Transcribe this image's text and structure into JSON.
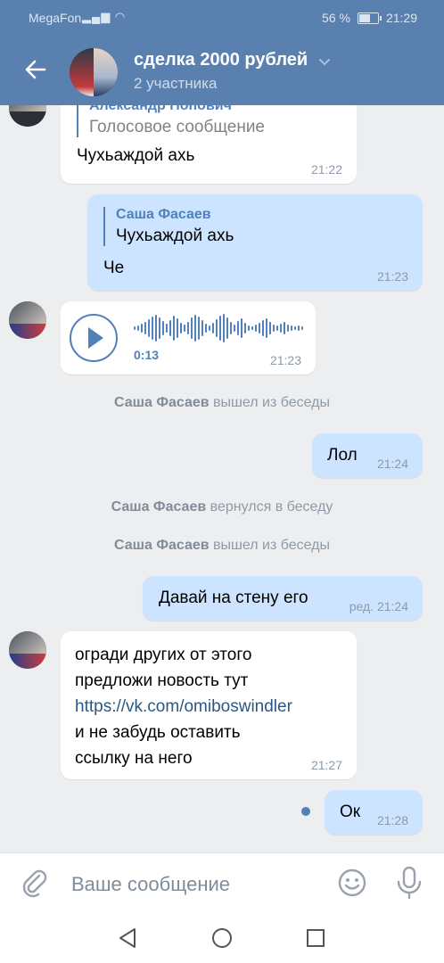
{
  "status_bar": {
    "carrier": "MegaFon",
    "battery": "56 %",
    "time": "21:29"
  },
  "header": {
    "title": "сделка 2000 рублей",
    "subtitle": "2 участника",
    "back_icon": "arrow-left-icon",
    "chevron_icon": "chevron-down-icon"
  },
  "messages": {
    "m1": {
      "reply_author": "Александр Попович",
      "reply_text": "Голосовое сообщение",
      "text": "Чухьаждой ахь",
      "time": "21:22"
    },
    "m2": {
      "reply_author": "Саша Фасаев",
      "reply_text": "Чухьаждой ахь",
      "text": "Че",
      "time": "21:23"
    },
    "m3": {
      "duration": "0:13",
      "time": "21:23"
    },
    "s1": {
      "name": "Саша Фасаев",
      "action": "вышел из беседы"
    },
    "m4": {
      "text": "Лол",
      "time": "21:24"
    },
    "s2": {
      "name": "Саша Фасаев",
      "action": "вернулся в беседу"
    },
    "s3": {
      "name": "Саша Фасаев",
      "action": "вышел из беседы"
    },
    "m5": {
      "text": "Давай на стену его",
      "time": "ред. 21:24"
    },
    "m6": {
      "line1": "огради других от этого",
      "line2": "предложи новость тут",
      "link": "https://vk.com/omiboswindler",
      "line4": "и не забудь оставить",
      "line5": "ссылку на него",
      "time": "21:27"
    },
    "m7": {
      "text": "Ок",
      "time": "21:28"
    }
  },
  "composer": {
    "placeholder": "Ваше сообщение",
    "attach_icon": "paperclip-icon",
    "emoji_icon": "smile-icon",
    "mic_icon": "microphone-icon"
  },
  "colors": {
    "header": "#5a80b0",
    "accent": "#5181b8",
    "outgoing_bubble": "#cce4ff",
    "background": "#edeef0"
  }
}
